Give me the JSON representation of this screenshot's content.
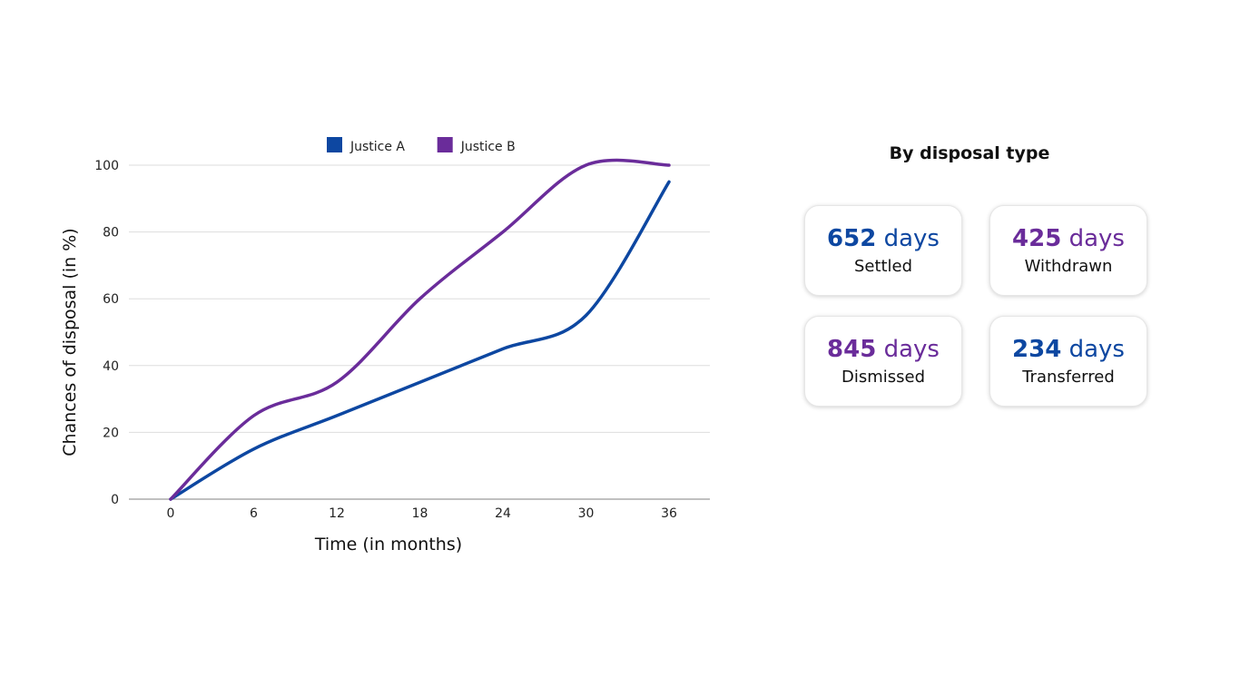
{
  "chart_data": {
    "type": "line",
    "xlabel": "Time (in months)",
    "ylabel": "Chances of disposal  (in %)",
    "x": [
      0,
      6,
      12,
      18,
      24,
      30,
      36
    ],
    "ylim": [
      0,
      100
    ],
    "yticks": [
      0,
      20,
      40,
      60,
      80,
      100
    ],
    "grid": true,
    "legend_position": "top",
    "series": [
      {
        "name": "Justice A",
        "color": "#0D47A1",
        "values": [
          0,
          15,
          25,
          35,
          45,
          55,
          95
        ]
      },
      {
        "name": "Justice B",
        "color": "#6A2C9A",
        "values": [
          0,
          25,
          35,
          60,
          80,
          100,
          100
        ]
      }
    ]
  },
  "panel": {
    "title": "By disposal type",
    "cards": [
      {
        "number": "652",
        "unit": "days",
        "label": "Settled",
        "color": "#0D47A1"
      },
      {
        "number": "425",
        "unit": "days",
        "label": "Withdrawn",
        "color": "#6A2C9A"
      },
      {
        "number": "845",
        "unit": "days",
        "label": "Dismissed",
        "color": "#6A2C9A"
      },
      {
        "number": "234",
        "unit": "days",
        "label": "Transferred",
        "color": "#0D47A1"
      }
    ]
  }
}
